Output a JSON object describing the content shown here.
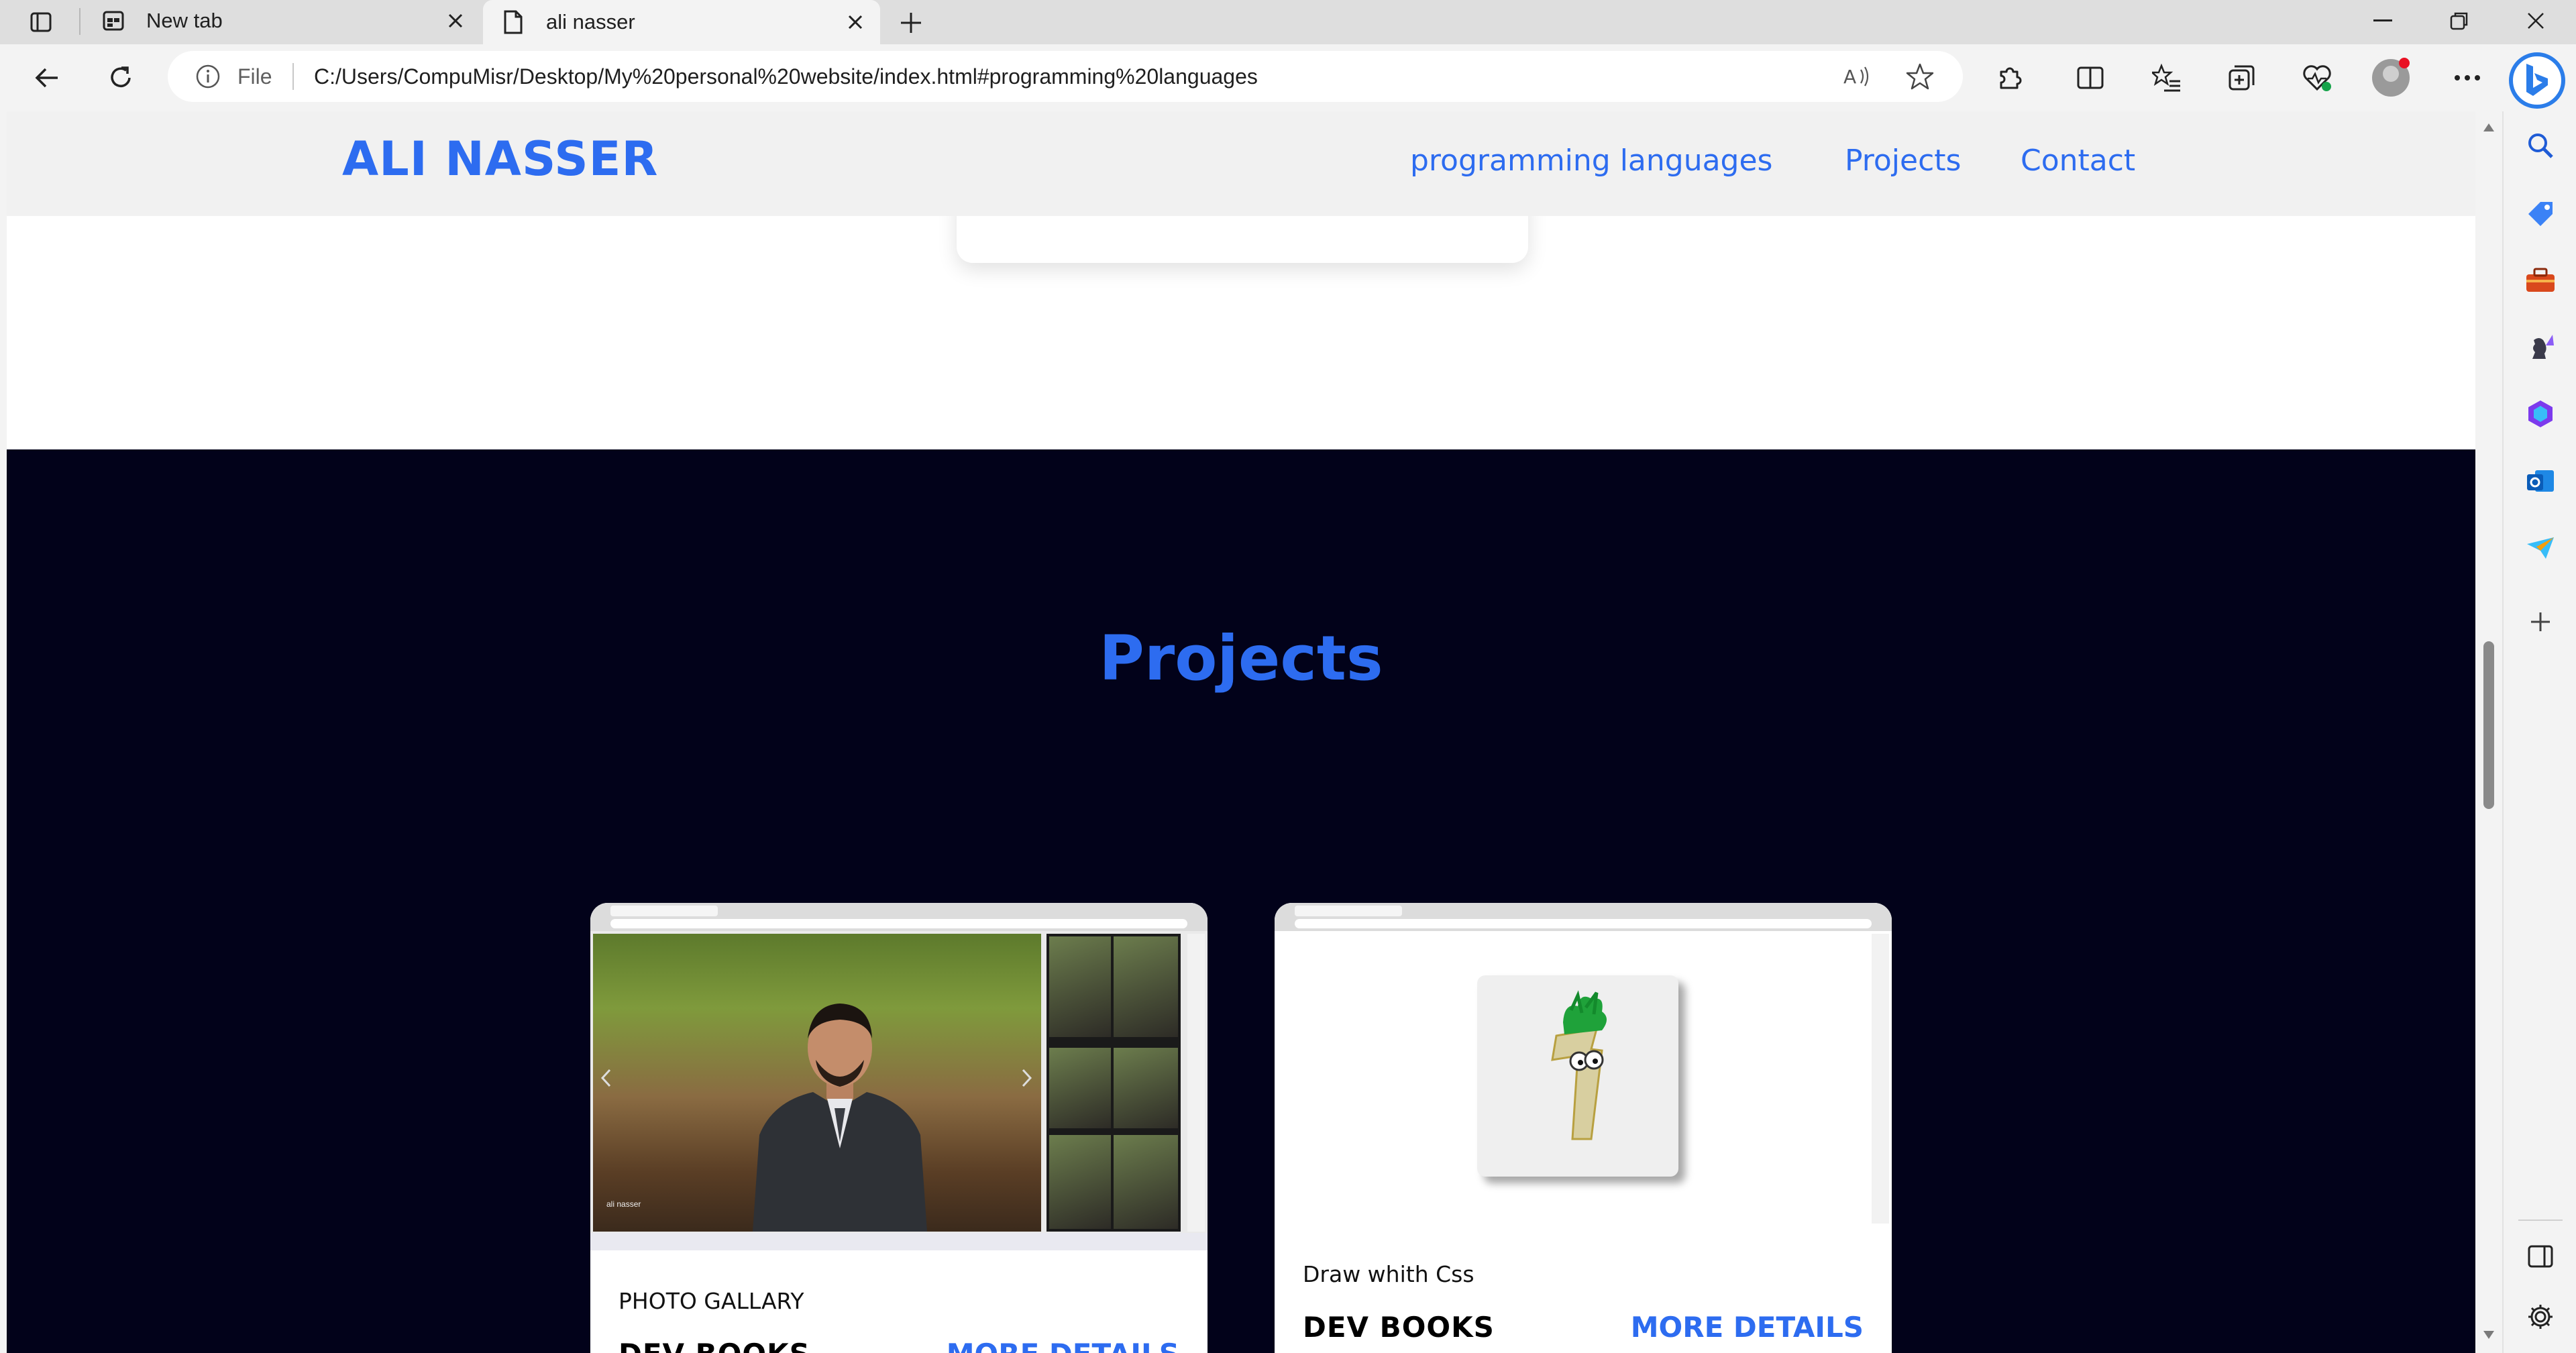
{
  "browser": {
    "tabs": [
      {
        "title": "New tab",
        "active": false,
        "icon": "new-tab-page-icon"
      },
      {
        "title": "ali nasser",
        "active": true,
        "icon": "document-icon"
      }
    ],
    "address": {
      "scheme_label": "File",
      "url": "C:/Users/CompuMisr/Desktop/My%20personal%20website/index.html#programming%20languages"
    },
    "accent_color": "#2b7de9"
  },
  "site": {
    "brand": "ALI NASSER",
    "nav": [
      "programming languages",
      "Projects",
      "Contact"
    ],
    "brand_color": "#2d6cf0",
    "section_bg": "#02021a",
    "projects": {
      "title": "Projects",
      "cards": [
        {
          "description": "PHOTO GALLARY",
          "title": "DEV BOOKS",
          "link": "MORE DETAILS",
          "screenshot_caption": "ali nasser"
        },
        {
          "description": "Draw whith Css",
          "title": "DEV BOOKS",
          "link": "MORE DETAILS"
        }
      ]
    }
  }
}
